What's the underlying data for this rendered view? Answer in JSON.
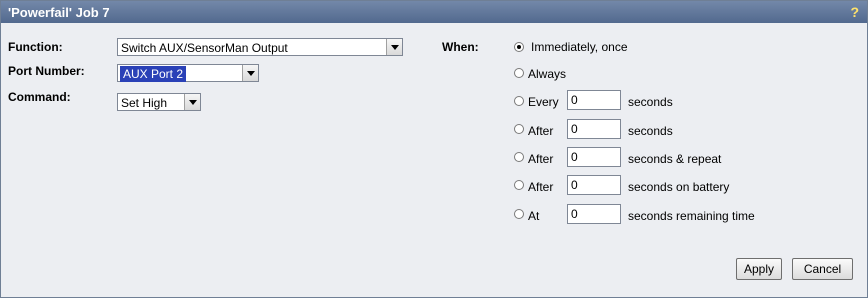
{
  "window": {
    "title": "'Powerfail' Job 7",
    "help": "?"
  },
  "form": {
    "function_label": "Function:",
    "function_value": "Switch AUX/SensorMan Output",
    "port_label": "Port Number:",
    "port_value": "AUX Port 2",
    "command_label": "Command:",
    "command_value": "Set High"
  },
  "when": {
    "label": "When:",
    "selected": "immediately",
    "options": [
      {
        "id": "immediately",
        "label": "Immediately, once"
      },
      {
        "id": "always",
        "label": "Always"
      },
      {
        "id": "every",
        "label": "Every",
        "value": "0",
        "unit": "seconds"
      },
      {
        "id": "after",
        "label": "After",
        "value": "0",
        "unit": "seconds"
      },
      {
        "id": "after-repeat",
        "label": "After",
        "value": "0",
        "unit": "seconds & repeat"
      },
      {
        "id": "after-battery",
        "label": "After",
        "value": "0",
        "unit": "seconds on battery"
      },
      {
        "id": "at",
        "label": "At",
        "value": "0",
        "unit": "seconds remaining time"
      }
    ]
  },
  "buttons": {
    "apply": "Apply",
    "cancel": "Cancel"
  }
}
